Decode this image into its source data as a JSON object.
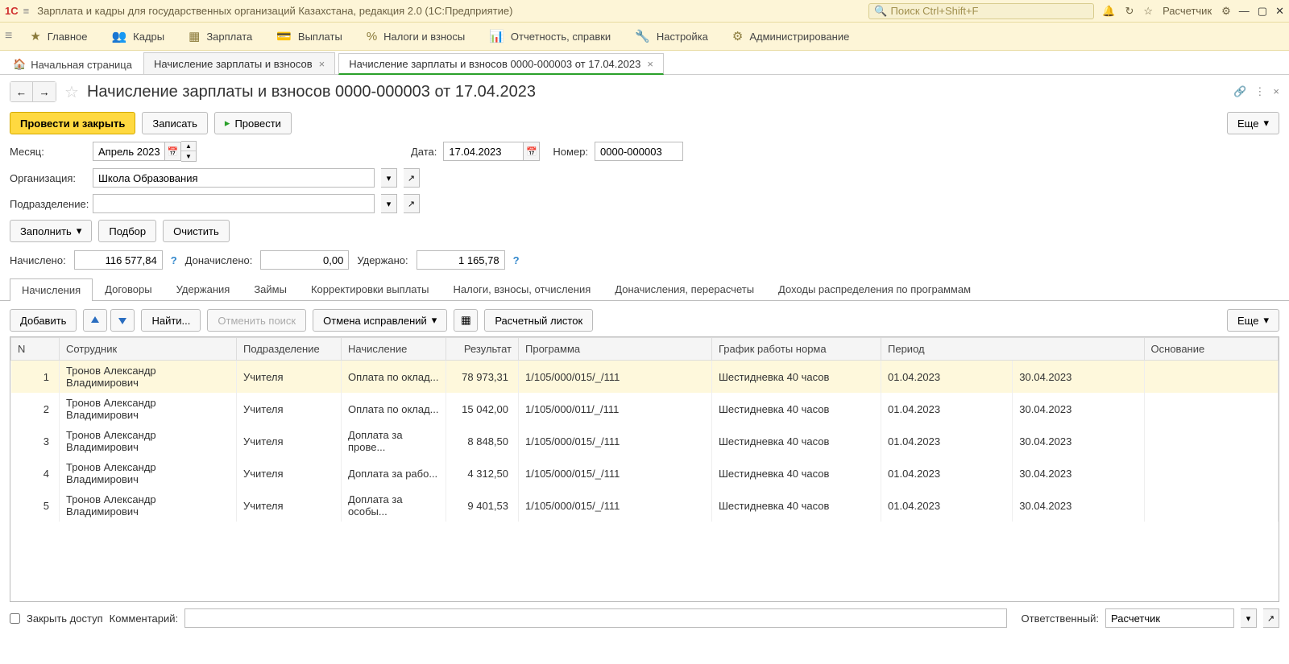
{
  "titlebar": {
    "app_title": "Зарплата и кадры для государственных организаций Казахстана, редакция 2.0  (1С:Предприятие)",
    "search_placeholder": "Поиск Ctrl+Shift+F",
    "user": "Расчетчик"
  },
  "mainmenu": {
    "items": [
      {
        "label": "Главное",
        "icon": "star"
      },
      {
        "label": "Кадры",
        "icon": "people"
      },
      {
        "label": "Зарплата",
        "icon": "grid"
      },
      {
        "label": "Выплаты",
        "icon": "wallet"
      },
      {
        "label": "Налоги и взносы",
        "icon": "percent"
      },
      {
        "label": "Отчетность, справки",
        "icon": "report"
      },
      {
        "label": "Настройка",
        "icon": "wrench"
      },
      {
        "label": "Администрирование",
        "icon": "gear"
      }
    ]
  },
  "tabs": {
    "home": "Начальная страница",
    "tab1": "Начисление зарплаты и взносов",
    "tab2": "Начисление зарплаты и взносов 0000-000003 от 17.04.2023"
  },
  "doc": {
    "title": "Начисление зарплаты и взносов 0000-000003 от 17.04.2023",
    "btn_post_close": "Провести и закрыть",
    "btn_save": "Записать",
    "btn_post": "Провести",
    "more": "Еще",
    "month_label": "Месяц:",
    "month_value": "Апрель 2023",
    "date_label": "Дата:",
    "date_value": "17.04.2023",
    "number_label": "Номер:",
    "number_value": "0000-000003",
    "org_label": "Организация:",
    "org_value": "Школа Образования",
    "dept_label": "Подразделение:",
    "dept_value": "",
    "btn_fill": "Заполнить",
    "btn_select": "Подбор",
    "btn_clear": "Очистить",
    "charged_label": "Начислено:",
    "charged_value": "116 577,84",
    "extra_label": "Доначислено:",
    "extra_value": "0,00",
    "withheld_label": "Удержано:",
    "withheld_value": "1 165,78"
  },
  "doctabs": [
    "Начисления",
    "Договоры",
    "Удержания",
    "Займы",
    "Корректировки выплаты",
    "Налоги, взносы, отчисления",
    "Доначисления, перерасчеты",
    "Доходы распределения по программам"
  ],
  "tbltoolbar": {
    "add": "Добавить",
    "find": "Найти...",
    "cancel_search": "Отменить поиск",
    "cancel_fix": "Отмена исправлений",
    "payslip": "Расчетный листок",
    "more": "Еще"
  },
  "columns": {
    "n": "N",
    "emp": "Сотрудник",
    "dept": "Подразделение",
    "charge": "Начисление",
    "res": "Результат",
    "prog": "Программа",
    "sched": "График работы норма",
    "period": "Период",
    "basis": "Основание"
  },
  "rows": [
    {
      "n": "1",
      "emp": "Тронов Александр Владимирович",
      "dept": "Учителя",
      "charge": "Оплата по оклад...",
      "res": "78 973,31",
      "prog": "1/105/000/015/_/111",
      "sched": "Шестидневка 40 часов",
      "p1": "01.04.2023",
      "p2": "30.04.2023"
    },
    {
      "n": "2",
      "emp": "Тронов Александр Владимирович",
      "dept": "Учителя",
      "charge": "Оплата по оклад...",
      "res": "15 042,00",
      "prog": "1/105/000/011/_/111",
      "sched": "Шестидневка 40 часов",
      "p1": "01.04.2023",
      "p2": "30.04.2023"
    },
    {
      "n": "3",
      "emp": "Тронов Александр Владимирович",
      "dept": "Учителя",
      "charge": "Доплата за прове...",
      "res": "8 848,50",
      "prog": "1/105/000/015/_/111",
      "sched": "Шестидневка 40 часов",
      "p1": "01.04.2023",
      "p2": "30.04.2023"
    },
    {
      "n": "4",
      "emp": "Тронов Александр Владимирович",
      "dept": "Учителя",
      "charge": "Доплата за рабо...",
      "res": "4 312,50",
      "prog": "1/105/000/015/_/111",
      "sched": "Шестидневка 40 часов",
      "p1": "01.04.2023",
      "p2": "30.04.2023"
    },
    {
      "n": "5",
      "emp": "Тронов Александр Владимирович",
      "dept": "Учителя",
      "charge": "Доплата за особы...",
      "res": "9 401,53",
      "prog": "1/105/000/015/_/111",
      "sched": "Шестидневка 40 часов",
      "p1": "01.04.2023",
      "p2": "30.04.2023"
    }
  ],
  "footer": {
    "lock": "Закрыть доступ",
    "comment_label": "Комментарий:",
    "resp_label": "Ответственный:",
    "resp_value": "Расчетчик"
  }
}
